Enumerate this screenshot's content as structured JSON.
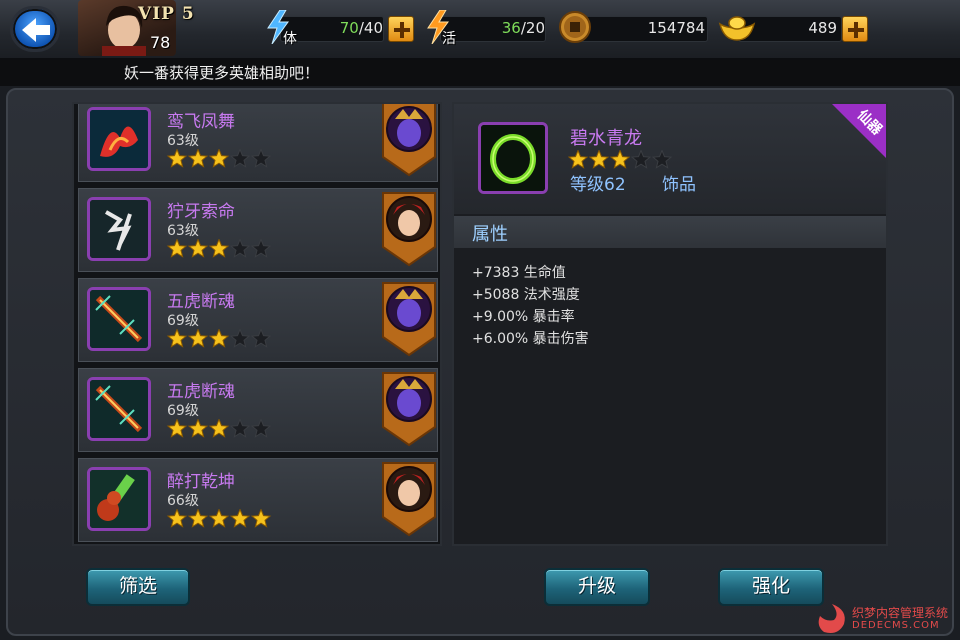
{
  "header": {
    "vip_label": "VIP 5",
    "player_level": "78",
    "stamina": {
      "label": "体",
      "current": "70",
      "max": "/40"
    },
    "energy": {
      "label": "活",
      "current": "36",
      "max": "/20"
    },
    "coins": "154784",
    "ingots": "489"
  },
  "message": "妖一番获得更多英雄相助吧！",
  "items": [
    {
      "name": "鸾飞凤舞",
      "level": "63级",
      "stars": 3,
      "icon": "phoenix-icon",
      "hero": "hero-purple-demon"
    },
    {
      "name": "狞牙索命",
      "level": "63级",
      "stars": 3,
      "icon": "rune-blade-icon",
      "hero": "hero-red-girl"
    },
    {
      "name": "五虎断魂",
      "level": "69级",
      "stars": 3,
      "icon": "tiger-sword-icon",
      "hero": "hero-purple-demon"
    },
    {
      "name": "五虎断魂",
      "level": "69级",
      "stars": 3,
      "icon": "tiger-sword-icon",
      "hero": "hero-purple-demon"
    },
    {
      "name": "醉打乾坤",
      "level": "66级",
      "stars": 5,
      "icon": "gourd-icon",
      "hero": "hero-red-girl"
    }
  ],
  "detail": {
    "name": "碧水青龙",
    "stars": 3,
    "level": "等级62",
    "type": "饰品",
    "badge": "仙器",
    "attr_title": "属性",
    "attrs": [
      "+7383 生命值",
      "+5088 法术强度",
      "+9.00% 暴击率",
      "+6.00% 暴击伤害"
    ]
  },
  "buttons": {
    "filter": "筛选",
    "upgrade": "升级",
    "enhance": "强化"
  },
  "watermark": {
    "line1": "织梦内容管理系统",
    "line2": "DEDECMS.COM"
  },
  "colors": {
    "quality_purple": "#c87af0",
    "star_gold": "#f6c21c",
    "accent_blue": "#8fc3ff"
  }
}
